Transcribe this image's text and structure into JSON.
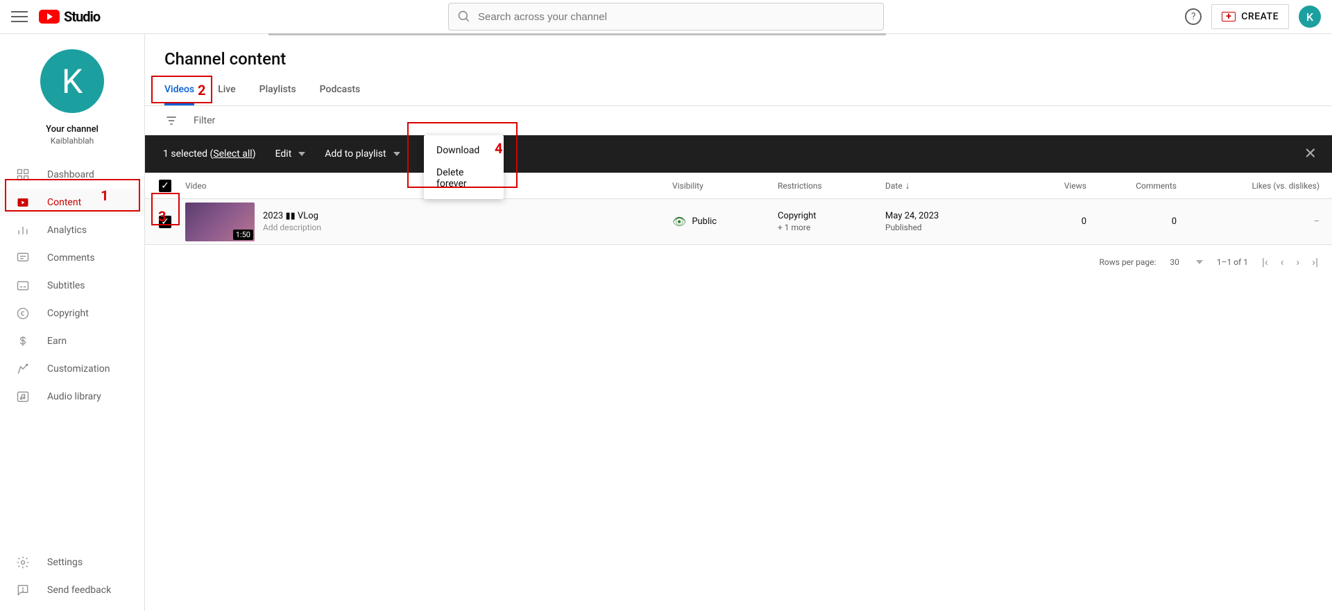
{
  "header": {
    "logo_text": "Studio",
    "search_placeholder": "Search across your channel",
    "create_label": "CREATE",
    "avatar_initial": "K"
  },
  "sidebar": {
    "avatar_initial": "K",
    "your_channel_label": "Your channel",
    "channel_name": "Kaiblahblah",
    "items": [
      {
        "label": "Dashboard"
      },
      {
        "label": "Content"
      },
      {
        "label": "Analytics"
      },
      {
        "label": "Comments"
      },
      {
        "label": "Subtitles"
      },
      {
        "label": "Copyright"
      },
      {
        "label": "Earn"
      },
      {
        "label": "Customization"
      },
      {
        "label": "Audio library"
      }
    ],
    "footer": [
      {
        "label": "Settings"
      },
      {
        "label": "Send feedback"
      }
    ]
  },
  "page": {
    "title": "Channel content",
    "tabs": [
      {
        "label": "Videos"
      },
      {
        "label": "Live"
      },
      {
        "label": "Playlists"
      },
      {
        "label": "Podcasts"
      }
    ],
    "filter_label": "Filter"
  },
  "action_bar": {
    "selected_text": "1 selected",
    "select_all_text": "Select all",
    "edit_label": "Edit",
    "add_playlist_label": "Add to playlist",
    "more_menu": [
      {
        "label": "Download"
      },
      {
        "label": "Delete forever"
      }
    ]
  },
  "table": {
    "columns": {
      "video": "Video",
      "visibility": "Visibility",
      "restrictions": "Restrictions",
      "date": "Date",
      "views": "Views",
      "comments": "Comments",
      "likes": "Likes (vs. dislikes)"
    },
    "rows": [
      {
        "title": "2023 ▮▮ VLog",
        "description": "Add description",
        "duration": "1:50",
        "visibility": "Public",
        "restrictions": "Copyright",
        "restrictions_more": "+ 1 more",
        "date": "May 24, 2023",
        "date_status": "Published",
        "views": "0",
        "comments": "0",
        "likes": "–"
      }
    ],
    "pagination": {
      "rows_per_page_label": "Rows per page:",
      "rows_per_page_value": "30",
      "range_text": "1–1 of 1"
    }
  },
  "callouts": {
    "1": "1",
    "2": "2",
    "3": "3",
    "4": "4"
  }
}
